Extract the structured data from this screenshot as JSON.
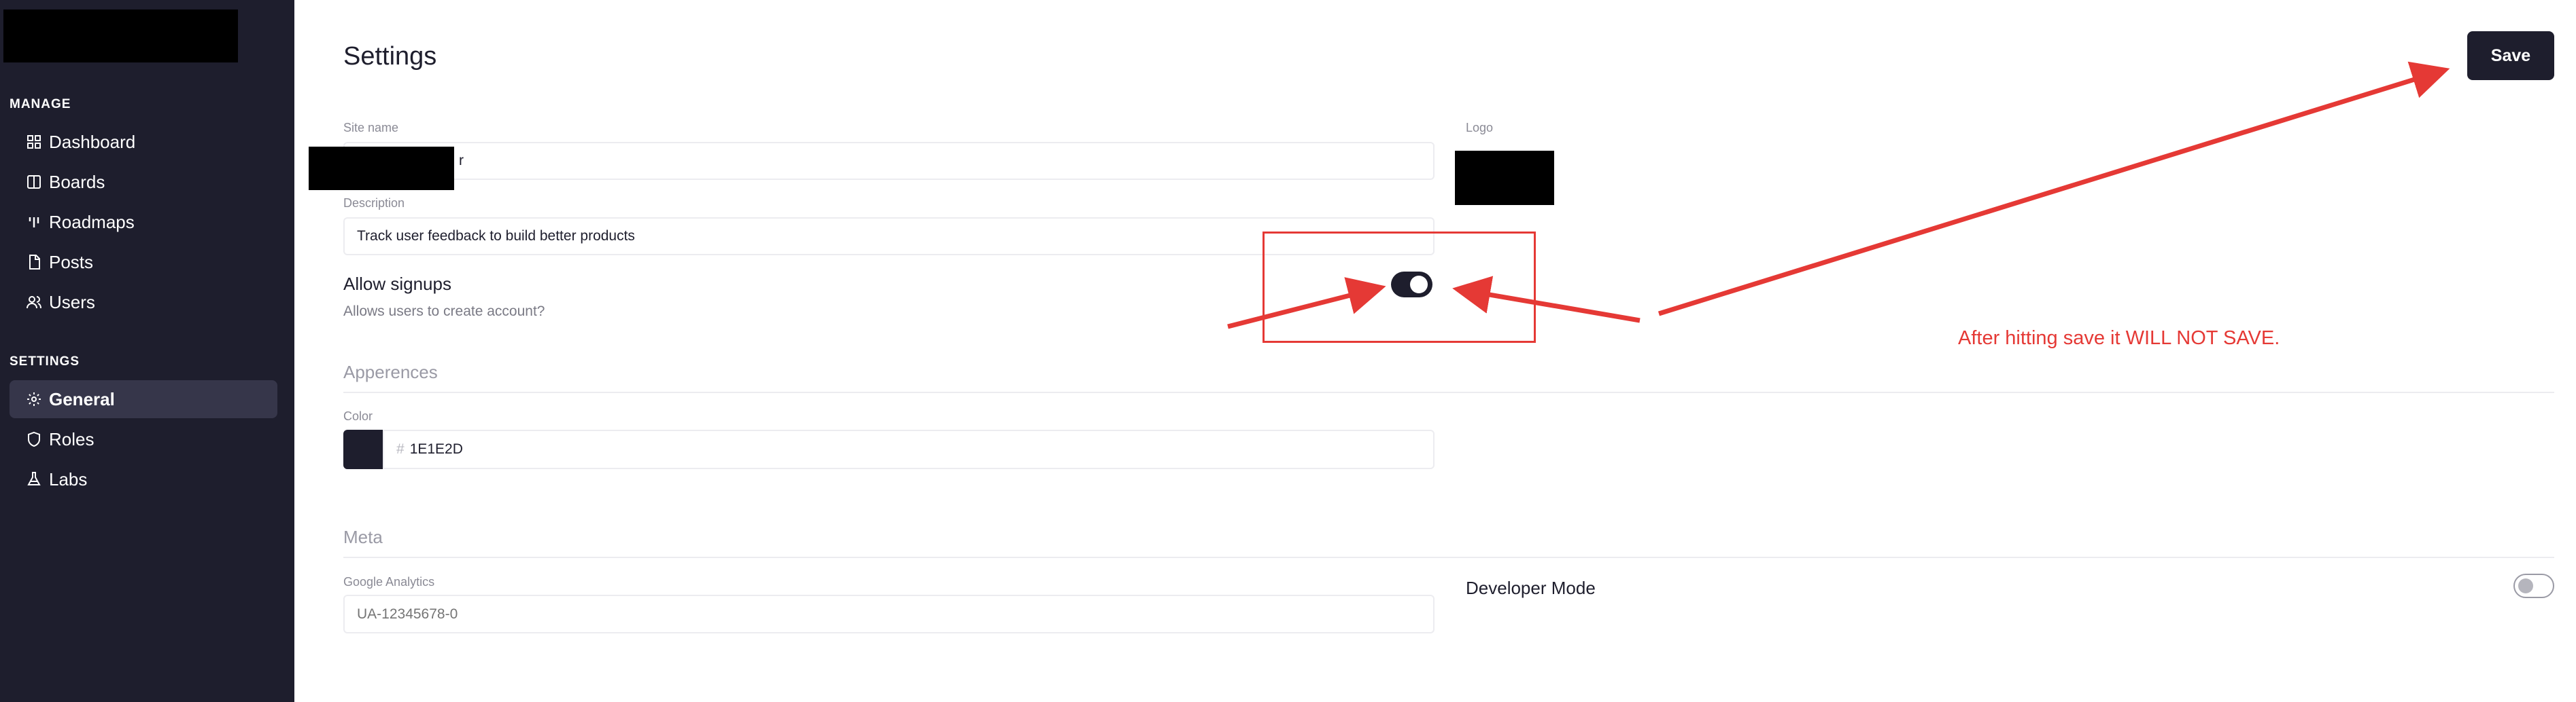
{
  "sidebar": {
    "manage_label": "MANAGE",
    "settings_label": "SETTINGS",
    "manage_items": [
      {
        "label": "Dashboard",
        "icon": "dashboard-icon"
      },
      {
        "label": "Boards",
        "icon": "boards-icon"
      },
      {
        "label": "Roadmaps",
        "icon": "roadmaps-icon"
      },
      {
        "label": "Posts",
        "icon": "posts-icon"
      },
      {
        "label": "Users",
        "icon": "users-icon"
      }
    ],
    "settings_items": [
      {
        "label": "General",
        "icon": "gear-icon",
        "active": true
      },
      {
        "label": "Roles",
        "icon": "shield-icon"
      },
      {
        "label": "Labs",
        "icon": "flask-icon"
      }
    ]
  },
  "header": {
    "title": "Settings",
    "save_label": "Save"
  },
  "general": {
    "site_name_label": "Site name",
    "site_name_value_visible_fragment": "r",
    "logo_label": "Logo",
    "description_label": "Description",
    "description_value": "Track user feedback to build better products",
    "allow_signups_title": "Allow signups",
    "allow_signups_desc": "Allows users to create account?",
    "allow_signups_on": true
  },
  "appearances": {
    "heading": "Apperences",
    "color_label": "Color",
    "color_hash": "#",
    "color_value": "1E1E2D",
    "swatch_color": "#1e1e2d"
  },
  "meta": {
    "heading": "Meta",
    "ga_label": "Google Analytics",
    "ga_placeholder": "UA-12345678-0",
    "developer_mode_label": "Developer Mode",
    "developer_mode_on": false
  },
  "annotation": {
    "text": "After hitting save it WILL NOT SAVE.",
    "color": "#e53935"
  },
  "colors": {
    "sidebar_bg": "#1e1e2d",
    "accent": "#1e1e2d",
    "annotation_red": "#e53935"
  }
}
